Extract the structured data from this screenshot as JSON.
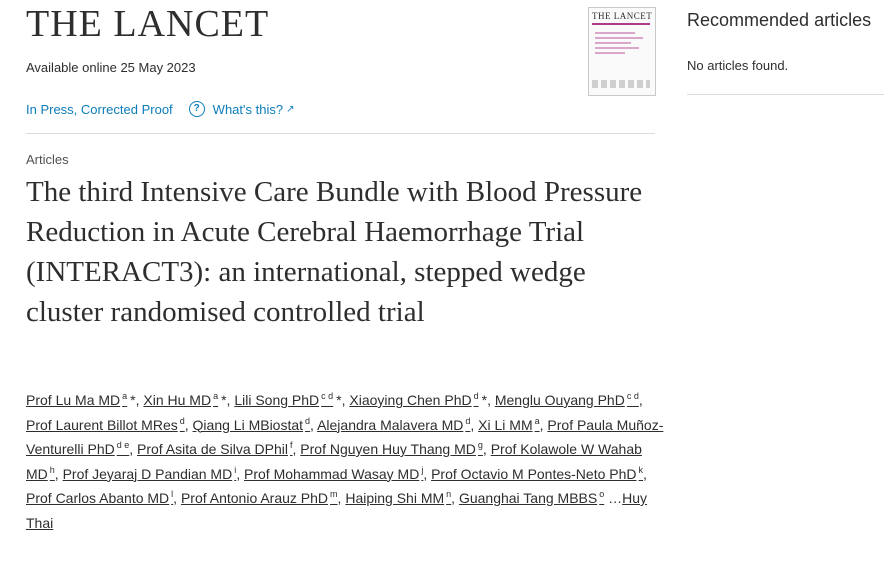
{
  "header": {
    "journal_name": "THE LANCET",
    "available_online": "Available online 25 May 2023",
    "status_label": "In Press, Corrected Proof",
    "help_label": "What's this?",
    "cover_title": "THE LANCET"
  },
  "article": {
    "section": "Articles",
    "title": "The third Intensive Care Bundle with Blood Pressure Reduction in Acute Cerebral Haemorrhage Trial (INTERACT3): an international, stepped wedge cluster randomised controlled trial",
    "authors": [
      {
        "name": "Prof Lu Ma MD",
        "sup": "a",
        "star": "*"
      },
      {
        "name": "Xin Hu MD",
        "sup": "a",
        "star": "*"
      },
      {
        "name": "Lili Song PhD",
        "sup": "c d",
        "star": "*"
      },
      {
        "name": "Xiaoying Chen PhD",
        "sup": "d",
        "star": "*"
      },
      {
        "name": "Menglu Ouyang PhD",
        "sup": "c d",
        "star": ""
      },
      {
        "name": "Prof Laurent Billot MRes",
        "sup": "d",
        "star": ""
      },
      {
        "name": "Qiang Li MBiostat",
        "sup": "d",
        "star": ""
      },
      {
        "name": "Alejandra Malavera MD",
        "sup": "d",
        "star": ""
      },
      {
        "name": "Xi Li MM",
        "sup": "a",
        "star": ""
      },
      {
        "name": "Prof Paula Muñoz-Venturelli PhD",
        "sup": "d e",
        "star": ""
      },
      {
        "name": "Prof Asita de Silva DPhil",
        "sup": "f",
        "star": ""
      },
      {
        "name": "Prof Nguyen Huy Thang MD",
        "sup": "g",
        "star": ""
      },
      {
        "name": "Prof Kolawole W Wahab MD",
        "sup": "h",
        "star": ""
      },
      {
        "name": "Prof Jeyaraj D Pandian MD",
        "sup": "i",
        "star": ""
      },
      {
        "name": "Prof Mohammad Wasay MD",
        "sup": "j",
        "star": ""
      },
      {
        "name": "Prof Octavio M Pontes-Neto PhD",
        "sup": "k",
        "star": ""
      },
      {
        "name": "Prof Carlos Abanto MD",
        "sup": "l",
        "star": ""
      },
      {
        "name": "Prof Antonio Arauz PhD",
        "sup": "m",
        "star": ""
      },
      {
        "name": "Haiping Shi MM",
        "sup": "n",
        "star": ""
      },
      {
        "name": "Guanghai Tang MBBS",
        "sup": "o",
        "star": ""
      }
    ],
    "more_prefix": "…",
    "last_author": "Huy Thai"
  },
  "recommended": {
    "title": "Recommended articles",
    "empty_message": "No articles found."
  },
  "colors": {
    "link": "#0c7dbb",
    "text": "#2e2e2e",
    "divider": "#dcdcdc"
  },
  "icons": {
    "help": "question-circle-icon",
    "external": "external-link-icon"
  }
}
